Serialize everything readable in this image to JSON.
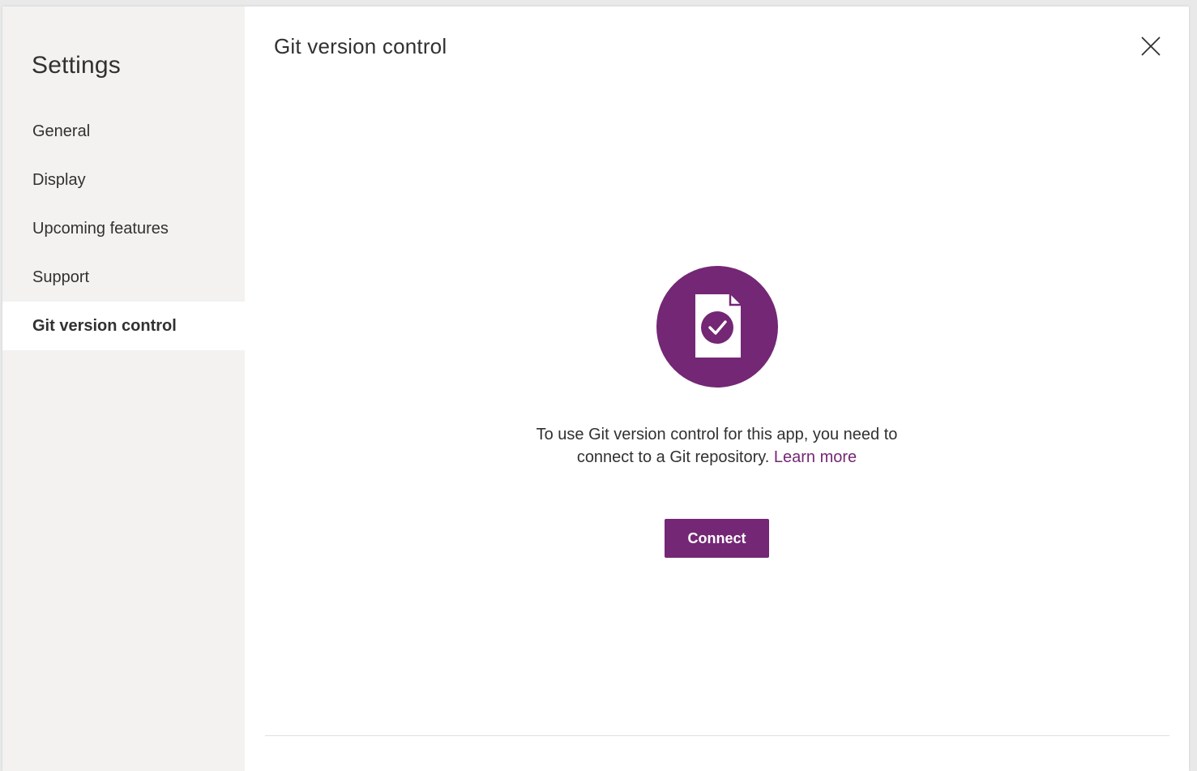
{
  "sidebar": {
    "title": "Settings",
    "items": [
      {
        "label": "General"
      },
      {
        "label": "Display"
      },
      {
        "label": "Upcoming features"
      },
      {
        "label": "Support"
      },
      {
        "label": "Git version control"
      }
    ],
    "active_item": "Git version control"
  },
  "panel": {
    "title": "Git version control",
    "close_icon": "close-icon",
    "hero_icon": "document-check-icon",
    "description": "To use Git version control for this app, you need to connect to a Git repository.",
    "learn_more_label": "Learn more",
    "connect_label": "Connect"
  },
  "colors": {
    "accent": "#742774",
    "sidebar_bg": "#f3f2f1",
    "text": "#323130"
  }
}
